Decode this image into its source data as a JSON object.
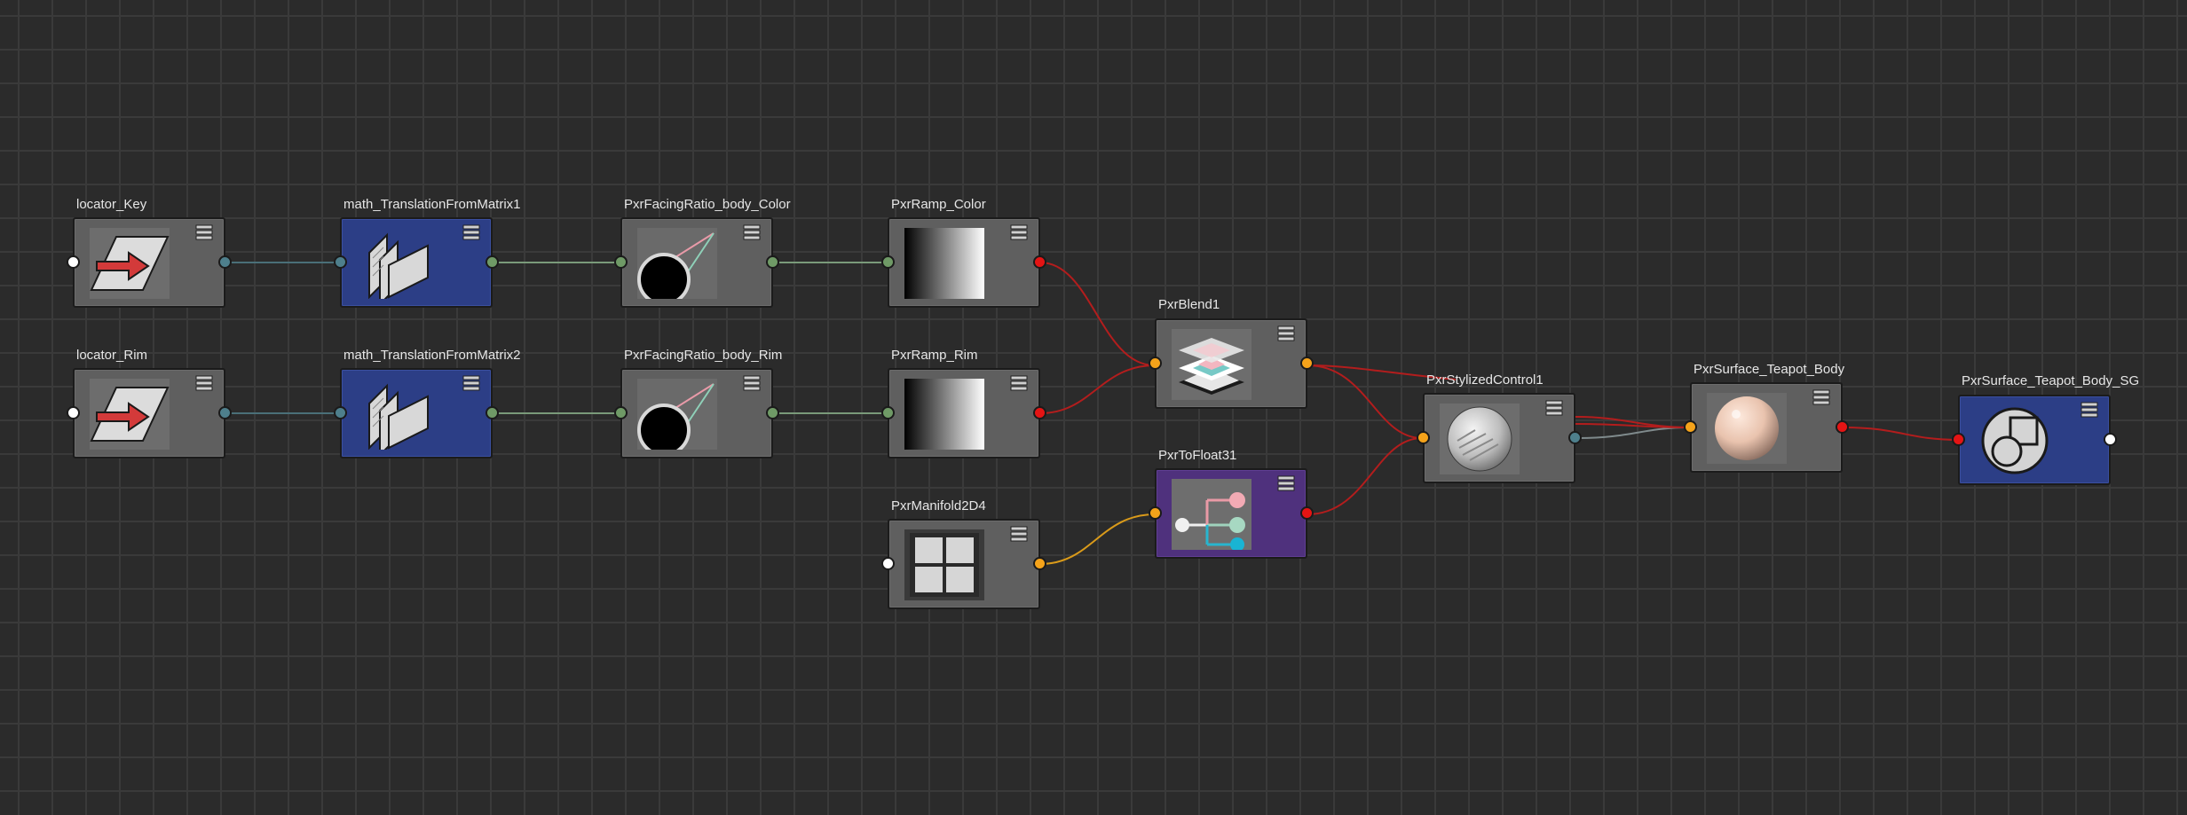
{
  "colors": {
    "background": "#2b2b2b",
    "grid": "#3a3a3a",
    "node_gray": "#5f5f5f",
    "node_blue": "#2c3e86",
    "node_purple": "#4f317d",
    "port_white": "#ffffff",
    "port_teal": "#4e7f8c",
    "port_green": "#6f9a66",
    "port_red": "#e51414",
    "port_orange": "#f5a31a",
    "wire_teal": "#4a6f78",
    "wire_green": "#7a9a7a",
    "wire_red": "#b31d1d",
    "wire_orange": "#d99a1a",
    "wire_gray": "#7f8a8c"
  },
  "nodes": {
    "locator_key": {
      "label": "locator_Key",
      "icon": "locator-icon"
    },
    "math_translation_1": {
      "label": "math_TranslationFromMatrix1",
      "icon": "matrix-layers-icon"
    },
    "facing_ratio_color": {
      "label": "PxrFacingRatio_body_Color",
      "icon": "facing-ratio-icon"
    },
    "ramp_color": {
      "label": "PxrRamp_Color",
      "icon": "ramp-gradient-icon"
    },
    "locator_rim": {
      "label": "locator_Rim",
      "icon": "locator-icon"
    },
    "math_translation_2": {
      "label": "math_TranslationFromMatrix2",
      "icon": "matrix-layers-icon"
    },
    "facing_ratio_rim": {
      "label": "PxrFacingRatio_body_Rim",
      "icon": "facing-ratio-icon"
    },
    "ramp_rim": {
      "label": "PxrRamp_Rim",
      "icon": "ramp-gradient-icon"
    },
    "blend": {
      "label": "PxrBlend1",
      "icon": "blend-layers-icon"
    },
    "manifold": {
      "label": "PxrManifold2D4",
      "icon": "manifold-grid-icon"
    },
    "to_float": {
      "label": "PxrToFloat31",
      "icon": "to-float-tree-icon"
    },
    "stylized_control": {
      "label": "PxrStylizedControl1",
      "icon": "stylized-sphere-icon"
    },
    "surface_body": {
      "label": "PxrSurface_Teapot_Body",
      "icon": "skin-sphere-icon"
    },
    "surface_body_sg": {
      "label": "PxrSurface_Teapot_Body_SG",
      "icon": "shading-group-icon"
    }
  }
}
